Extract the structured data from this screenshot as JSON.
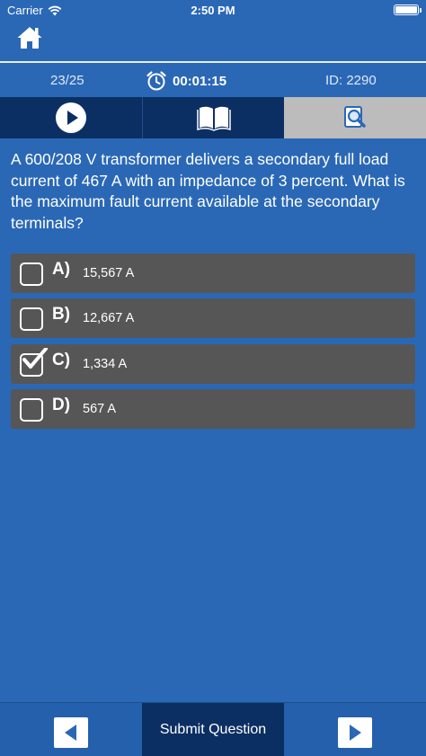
{
  "status_bar": {
    "carrier": "Carrier",
    "time": "2:50 PM"
  },
  "header": {
    "home_icon": "home-icon"
  },
  "info": {
    "question_count": "23/25",
    "timer": "00:01:15",
    "question_id": "ID: 2290"
  },
  "toolbar": {
    "items": [
      {
        "icon": "play-icon",
        "active": false
      },
      {
        "icon": "book-icon",
        "active": false
      },
      {
        "icon": "search-icon",
        "active": true
      }
    ]
  },
  "question": {
    "text": "A 600/208 V transformer delivers a secondary full load current of 467 A with an impedance of 3 percent. What is the maximum fault current available at the secondary terminals?"
  },
  "answers": [
    {
      "letter": "A)",
      "text": "15,567 A",
      "checked": false
    },
    {
      "letter": "B)",
      "text": "12,667 A",
      "checked": false
    },
    {
      "letter": "C)",
      "text": "1,334 A",
      "checked": true
    },
    {
      "letter": "D)",
      "text": "567 A",
      "checked": false
    }
  ],
  "bottom_bar": {
    "submit_label": "Submit Question",
    "prev_icon": "arrow-left-icon",
    "next_icon": "arrow-right-icon"
  },
  "colors": {
    "background": "#2a68b6",
    "toolbar_dark": "#0c2f63",
    "toolbar_active": "#bcbcbc",
    "answer_bg": "#565656"
  }
}
